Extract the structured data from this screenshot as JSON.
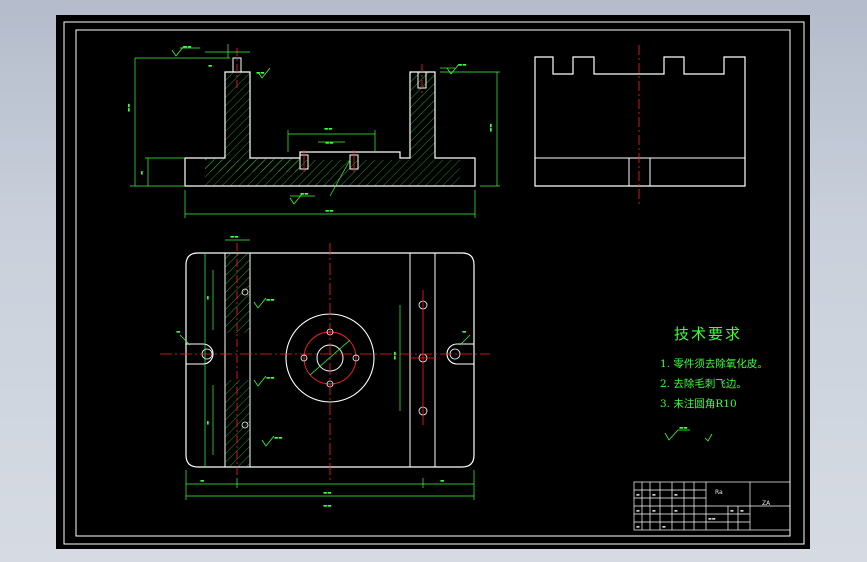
{
  "technical_requirements": {
    "title": "技术要求",
    "items": [
      "1. 零件须去除氧化皮。",
      "2. 去除毛刺飞边。",
      "3. 未注圆角R10"
    ]
  },
  "title_block": {
    "mark_left": "Ra",
    "mark_right": "ZA"
  },
  "colors": {
    "background": "#000000",
    "outline": "#ffffff",
    "dimension": "#3dff3d",
    "centerline": "#ff2020",
    "hatch": "#3dff3d",
    "window": "#c3cad6"
  }
}
